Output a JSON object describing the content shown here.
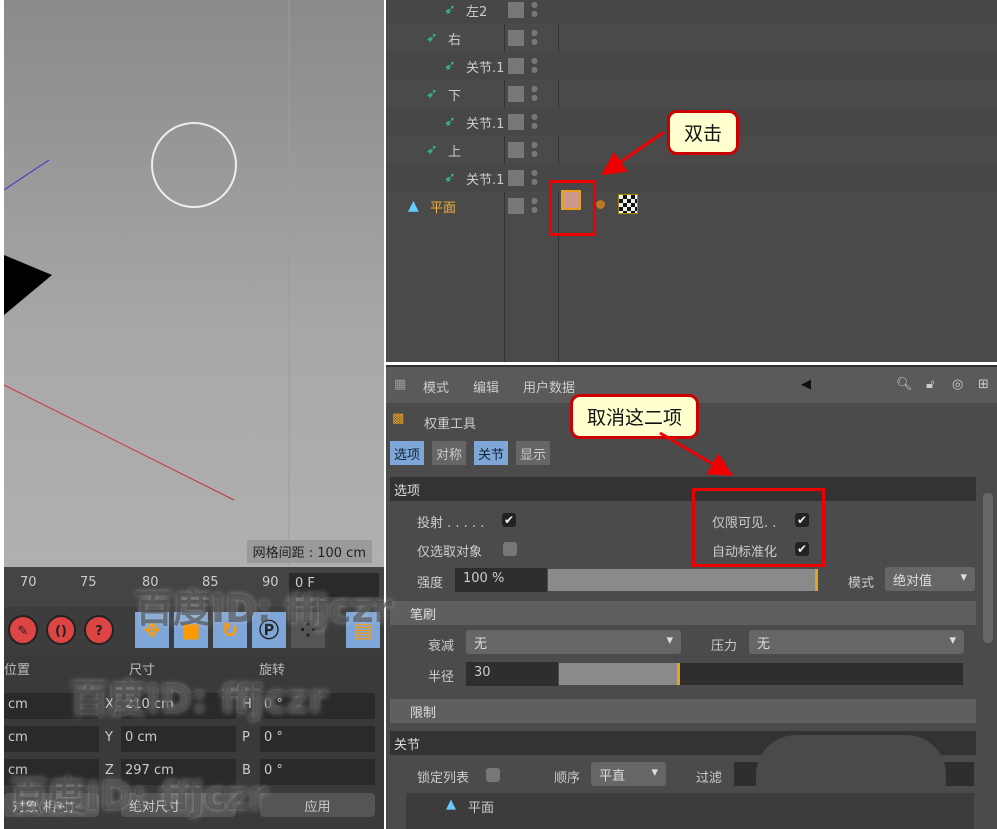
{
  "viewport": {
    "grid_spacing": "网格间距 : 100 cm"
  },
  "timeline": {
    "ticks": [
      "70",
      "75",
      "80",
      "85",
      "90"
    ],
    "frame": "0 F"
  },
  "toolbar": {
    "buttons": [
      "wrench-icon",
      "loop-icon",
      "help-icon"
    ],
    "mode_buttons": [
      "move-icon",
      "scale-icon",
      "rotate-icon",
      "p-icon",
      "points-icon",
      "film-icon"
    ]
  },
  "coords": {
    "headers": [
      "位置",
      "尺寸",
      "旋转"
    ],
    "rows": [
      {
        "pos": "cm",
        "axis": "X",
        "size": "210 cm",
        "rlabel": "H",
        "rot": "0 °"
      },
      {
        "pos": "cm",
        "axis": "Y",
        "size": "0 cm",
        "rlabel": "P",
        "rot": "0 °"
      },
      {
        "pos": "cm",
        "axis": "Z",
        "size": "297 cm",
        "rlabel": "B",
        "rot": "0 °"
      }
    ],
    "mode1": "对象(相对)",
    "mode2": "绝对尺寸",
    "apply": "应用"
  },
  "objects": [
    {
      "name": "左2",
      "indent": 2
    },
    {
      "name": "右",
      "indent": 1
    },
    {
      "name": "关节.1",
      "indent": 2
    },
    {
      "name": "下",
      "indent": 1
    },
    {
      "name": "关节.1",
      "indent": 2
    },
    {
      "name": "上",
      "indent": 1
    },
    {
      "name": "关节.1",
      "indent": 2
    },
    {
      "name": "平面",
      "indent": 0,
      "highlight": true
    }
  ],
  "attr": {
    "menu": [
      "模式",
      "编辑",
      "用户数据"
    ],
    "tool_title": "权重工具",
    "tabs": [
      {
        "label": "选项",
        "active": true
      },
      {
        "label": "对称",
        "active": false
      },
      {
        "label": "关节",
        "active": true
      },
      {
        "label": "显示",
        "active": false
      }
    ],
    "options": {
      "title": "选项",
      "project": "投射 . . . . .",
      "project_checked": true,
      "selected_only": "仅选取对象",
      "selected_only_checked": false,
      "visible_only": "仅限可见. .",
      "visible_only_checked": true,
      "auto_normalize": "自动标准化",
      "auto_normalize_checked": true,
      "strength_label": "强度",
      "strength": "100 %",
      "strength_fraction": 1.0,
      "mode_label": "模式",
      "mode": "绝对值"
    },
    "brush": {
      "title": "笔刷",
      "falloff_label": "衰减",
      "falloff": "无",
      "pressure_label": "压力",
      "pressure": "无",
      "radius_label": "半径",
      "radius": "30",
      "radius_fraction": 0.3
    },
    "limit": {
      "title": "限制"
    },
    "joints": {
      "title": "关节",
      "lock_label": "锁定列表",
      "order_label": "顺序",
      "order": "平直",
      "filter_label": "过滤",
      "tree_item": "平面"
    }
  },
  "annotations": {
    "double_click": "双击",
    "uncheck": "取消这二项"
  },
  "watermark": "百度ID: ffjczr",
  "colors": {
    "accent": "#7fa6d8",
    "highlight_text": "#f0b030",
    "annotation": "#e00000"
  }
}
